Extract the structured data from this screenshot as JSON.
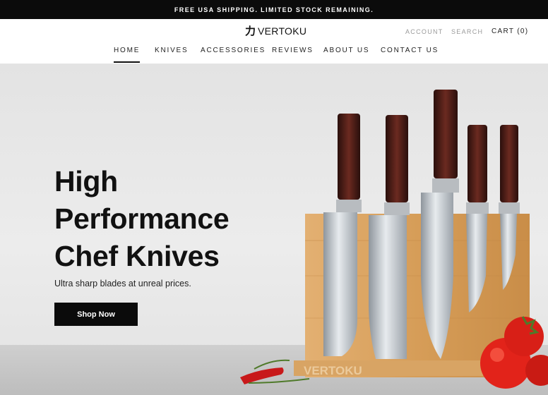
{
  "announcement": "FREE USA SHIPPING. LIMITED STOCK REMAINING.",
  "brand": {
    "mark": "力",
    "name": "VERTOKU"
  },
  "utility": {
    "account": "ACCOUNT",
    "search": "SEARCH",
    "cart_label": "CART",
    "cart_count": "(0)"
  },
  "nav": {
    "items": [
      {
        "label": "HOME",
        "active": true
      },
      {
        "label": "KNIVES"
      },
      {
        "label": "ACCESSORIES"
      },
      {
        "label": "REVIEWS"
      },
      {
        "label": "ABOUT US"
      },
      {
        "label": "CONTACT US"
      }
    ]
  },
  "hero": {
    "headline_lines": [
      "High",
      "Performance",
      "Chef Knives"
    ],
    "subheadline": "Ultra sharp blades at unreal prices.",
    "cta": "Shop Now",
    "block_engraving": "VERTOKU"
  },
  "colors": {
    "bar": "#0b0b0b",
    "accent_text": "#111111",
    "wood": "#d9a45f",
    "handle": "#4a1d16",
    "tomato": "#e2231a"
  }
}
